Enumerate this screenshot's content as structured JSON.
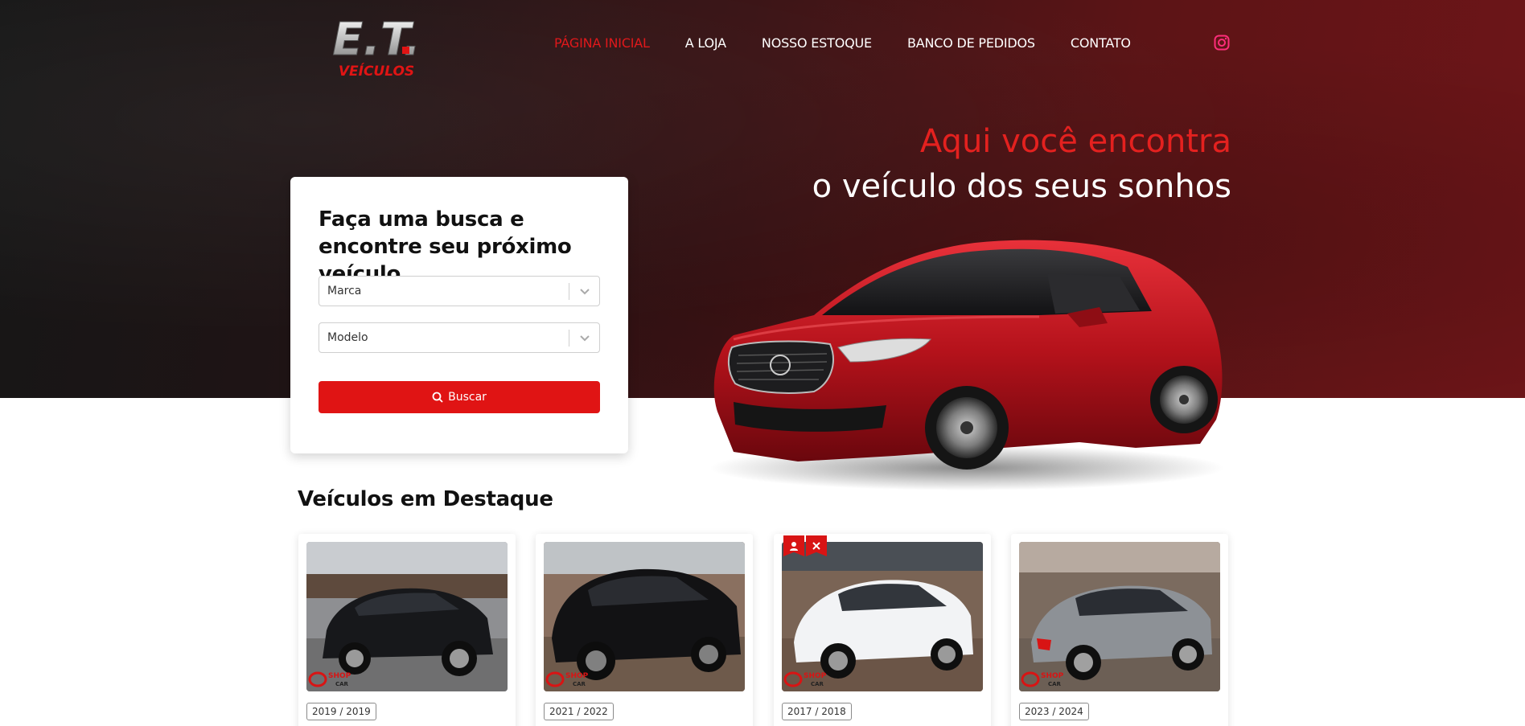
{
  "brand": {
    "logo_top": "E.T.",
    "logo_bottom": "VEÍCULOS"
  },
  "nav": {
    "items": [
      {
        "label": "PÁGINA INICIAL",
        "active": true
      },
      {
        "label": "A LOJA",
        "active": false
      },
      {
        "label": "NOSSO ESTOQUE",
        "active": false
      },
      {
        "label": "BANCO DE PEDIDOS",
        "active": false
      },
      {
        "label": "CONTATO",
        "active": false
      }
    ],
    "social_icon": "instagram-icon"
  },
  "hero": {
    "line1": "Aqui você encontra",
    "line2": "o veículo dos seus sonhos"
  },
  "search": {
    "title": "Faça uma busca e encontre seu próximo veículo",
    "brand_select": "Marca",
    "model_select": "Modelo",
    "button_label": "Buscar",
    "button_icon": "search-icon"
  },
  "featured": {
    "title": "Veículos em Destaque",
    "vehicles": [
      {
        "year": "2019 / 2019",
        "color": "black",
        "badges": false
      },
      {
        "year": "2021 / 2022",
        "color": "black",
        "badges": false
      },
      {
        "year": "2017 / 2018",
        "color": "white",
        "badges": true
      },
      {
        "year": "2023 / 2024",
        "color": "gray",
        "badges": false
      }
    ],
    "watermark": {
      "line1": "SHOP",
      "line2": "CAR"
    }
  },
  "colors": {
    "accent": "#e01414",
    "hero_dark": "#161616",
    "hero_red": "#6e1518"
  }
}
